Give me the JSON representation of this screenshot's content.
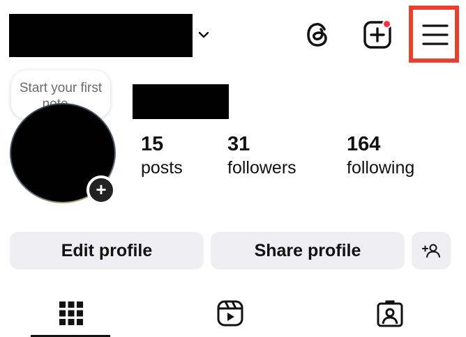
{
  "header": {
    "username": "",
    "icons": {
      "account_switcher": "chevron-down-icon",
      "threads": "threads-icon",
      "create": "create-plus-icon",
      "menu": "hamburger-menu-icon"
    },
    "notification_dot_color": "#ff2d3f",
    "highlight_color": "#e8412f"
  },
  "note": {
    "text": "Start your first note..."
  },
  "profile": {
    "name": "",
    "avatar_add_icon": "plus-icon",
    "avatar_add_label": "+"
  },
  "stats": [
    {
      "value": "15",
      "label": "posts"
    },
    {
      "value": "31",
      "label": "followers"
    },
    {
      "value": "164",
      "label": "following"
    }
  ],
  "buttons": {
    "edit_profile": "Edit profile",
    "share_profile": "Share profile",
    "discover_people_icon": "add-person-icon"
  },
  "tabs": [
    {
      "icon": "grid-icon",
      "active": true
    },
    {
      "icon": "reels-icon",
      "active": false
    },
    {
      "icon": "tagged-icon",
      "active": false
    }
  ],
  "colors": {
    "button_bg": "#efeff1",
    "text": "#111111"
  }
}
